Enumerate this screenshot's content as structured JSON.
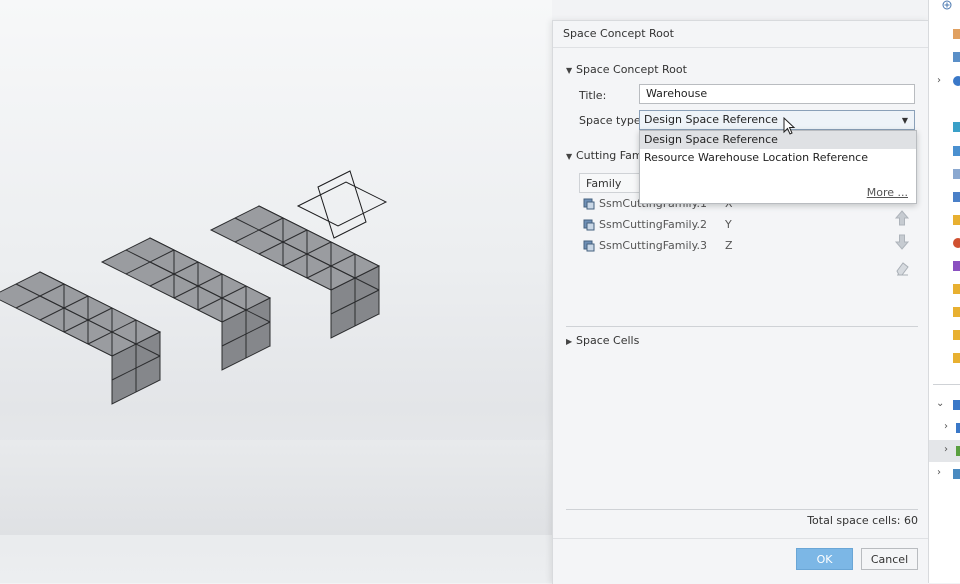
{
  "dialog": {
    "title": "Space Concept Root",
    "section_root": "Space Concept Root",
    "title_label": "Title:",
    "title_value": "Warehouse",
    "space_type_label": "Space type:",
    "space_type_value": "Design Space Reference",
    "space_type_options": [
      "Design Space Reference",
      "Resource Warehouse Location Reference"
    ],
    "more_link": "More ...",
    "section_cutting": "Cutting Fam",
    "family_header": "Family",
    "families": [
      {
        "name": "SsmCuttingFamily.1",
        "axis": "X"
      },
      {
        "name": "SsmCuttingFamily.2",
        "axis": "Y"
      },
      {
        "name": "SsmCuttingFamily.3",
        "axis": "Z"
      }
    ],
    "section_cells": "Space Cells",
    "total_cells": "Total space cells: 60",
    "ok_label": "OK",
    "cancel_label": "Cancel"
  },
  "icons": {
    "move_up": "arrow-up-icon",
    "move_down": "arrow-down-icon",
    "erase": "eraser-icon",
    "family": "cutting-family-icon"
  },
  "colors": {
    "accent": "#7cb7e6",
    "cube_top": "#9a9ca0",
    "cube_side": "#76787c"
  }
}
